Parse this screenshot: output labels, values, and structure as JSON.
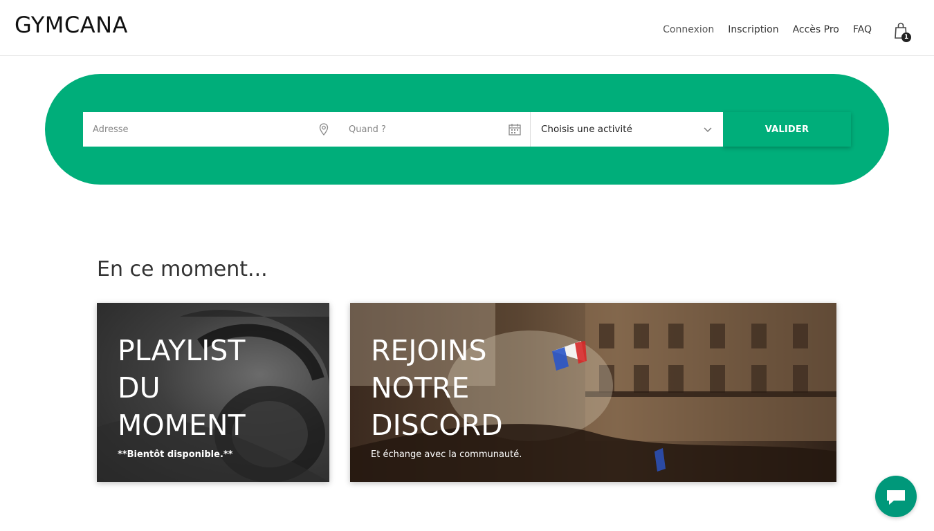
{
  "header": {
    "logo": "GYMCANA",
    "nav": [
      "Connexion",
      "Inscription",
      "Accès Pro",
      "FAQ"
    ],
    "cart_count": "1",
    "cart_icon": "shopping-bag-icon"
  },
  "search": {
    "address_placeholder": "Adresse",
    "address_icon": "location-pin-icon",
    "when_placeholder": "Quand ?",
    "when_icon": "calendar-icon",
    "activity_value": "Choisis une activité",
    "activity_icon": "chevron-down-icon",
    "submit_label": "VALIDER",
    "accent": "#00ae7a"
  },
  "section": {
    "title": "En ce moment..."
  },
  "cards": [
    {
      "title_lines": [
        "PLAYLIST",
        "DU",
        "MOMENT"
      ],
      "subtitle": "**Bientôt disponible.**"
    },
    {
      "title_lines": [
        "REJOINS",
        "NOTRE",
        "DISCORD"
      ],
      "subtitle": "Et échange avec la communauté."
    }
  ],
  "chat": {
    "icon": "chat-bubble-icon"
  }
}
